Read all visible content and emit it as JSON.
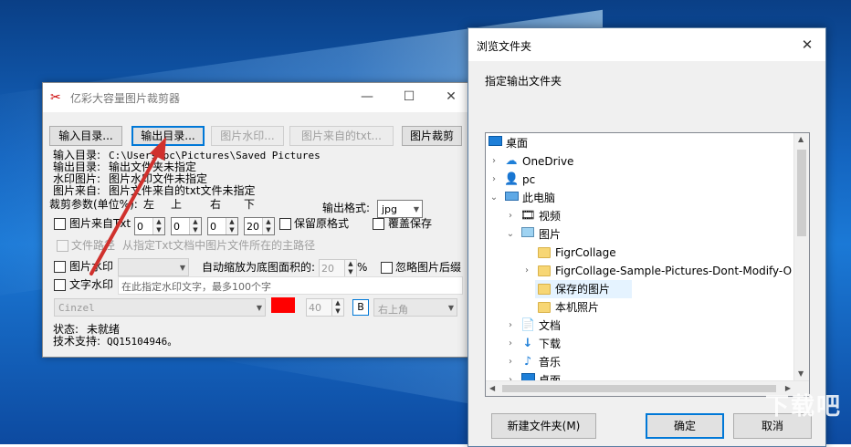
{
  "app": {
    "title": "亿彩大容量图片裁剪器",
    "toolbar": {
      "input_dir": "输入目录...",
      "output_dir": "输出目录...",
      "watermark_image": "图片水印...",
      "image_from_txt": "图片来自的txt...",
      "crop": "图片裁剪"
    },
    "info": {
      "input_label": "输入目录:",
      "input_value": "C:\\Users\\pc\\Pictures\\Saved Pictures",
      "output_label": "输出目录:",
      "output_value": "输出文件夹未指定",
      "watermark_label": "水印图片:",
      "watermark_value": "图片水印文件未指定",
      "from_label": "图片来自:",
      "from_value": "图片文件来自的txt文件未指定"
    },
    "crop_params": {
      "label": "裁剪参数(单位%):",
      "left": "左",
      "top": "上",
      "right": "右",
      "bottom": "下",
      "left_value": "0",
      "top_value": "0",
      "right_value": "0",
      "bottom_value": "20"
    },
    "output_format": {
      "label": "输出格式:",
      "value": "jpg"
    },
    "options": {
      "from_txt": "图片来自Txt",
      "keep_format": "保留原格式",
      "overwrite": "覆盖保存",
      "file_path": "文件路径",
      "file_path_hint": "从指定Txt文档中图片文件所在的主路径",
      "image_watermark": "图片水印",
      "auto_scale_label": "自动缩放为底图面积的:",
      "auto_scale_value": "20",
      "percent": "%",
      "ignore_images": "忽略图片后缀",
      "text_watermark": "文字水印",
      "text_watermark_placeholder": "在此指定水印文字，最多100个字"
    },
    "font": {
      "name": "Cinzel",
      "size": "40",
      "bold": "B",
      "position": "右上角",
      "color": "#ff0000"
    },
    "status": {
      "label": "状态:",
      "value": "未就绪"
    },
    "support": {
      "label": "技术支持:",
      "value": "QQ15104946。"
    }
  },
  "dialog": {
    "title": "浏览文件夹",
    "prompt": "指定输出文件夹",
    "tree": [
      {
        "label": "桌面",
        "icon": "desktop-icon"
      },
      {
        "label": "OneDrive",
        "icon": "cloud-icon"
      },
      {
        "label": "pc",
        "icon": "user-icon"
      },
      {
        "label": "此电脑",
        "icon": "computer-icon"
      },
      {
        "label": "视频",
        "icon": "video-icon"
      },
      {
        "label": "图片",
        "icon": "pictures-icon"
      },
      {
        "label": "FigrCollage",
        "icon": "folder-icon"
      },
      {
        "label": "FigrCollage-Sample-Pictures-Dont-Modify-O",
        "icon": "folder-icon"
      },
      {
        "label": "保存的图片",
        "icon": "folder-icon"
      },
      {
        "label": "本机照片",
        "icon": "folder-icon"
      },
      {
        "label": "文档",
        "icon": "documents-icon"
      },
      {
        "label": "下载",
        "icon": "download-icon"
      },
      {
        "label": "音乐",
        "icon": "music-icon"
      },
      {
        "label": "桌面",
        "icon": "desktop-icon"
      }
    ],
    "new_folder": "新建文件夹(M)",
    "ok": "确定",
    "cancel": "取消"
  },
  "watermark_text": "下载吧",
  "colors": {
    "accent": "#0078d7",
    "selection": "#e5f3ff",
    "arrow": "#d0312d"
  }
}
